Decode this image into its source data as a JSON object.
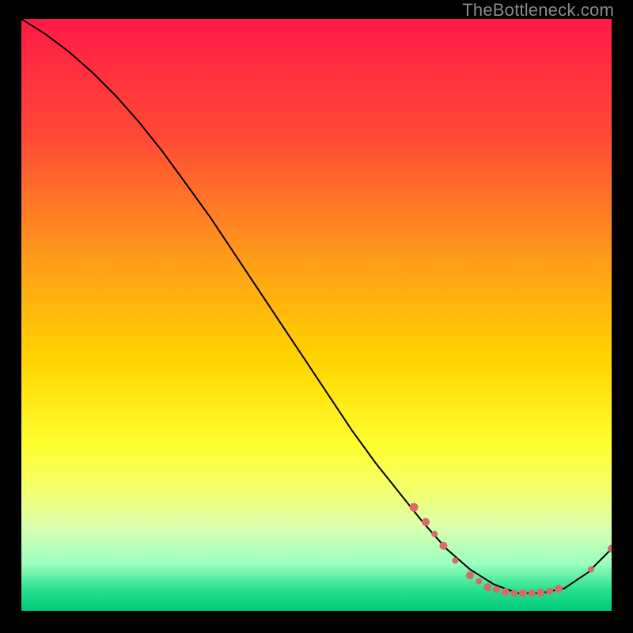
{
  "watermark": "TheBottleneck.com",
  "chart_data": {
    "type": "line",
    "title": "",
    "xlabel": "",
    "ylabel": "",
    "xlim": [
      0,
      100
    ],
    "ylim": [
      0,
      100
    ],
    "grid": false,
    "legend": false,
    "gradient_stops": [
      {
        "offset": 0.0,
        "color": "#ff1a46"
      },
      {
        "offset": 0.2,
        "color": "#ff4a36"
      },
      {
        "offset": 0.4,
        "color": "#ff9a1a"
      },
      {
        "offset": 0.58,
        "color": "#ffd500"
      },
      {
        "offset": 0.72,
        "color": "#ffff30"
      },
      {
        "offset": 0.8,
        "color": "#f4ff70"
      },
      {
        "offset": 0.86,
        "color": "#d8ffb0"
      },
      {
        "offset": 0.92,
        "color": "#9affc0"
      },
      {
        "offset": 0.965,
        "color": "#27e08e"
      },
      {
        "offset": 1.0,
        "color": "#00c97a"
      }
    ],
    "series": [
      {
        "name": "curve",
        "color": "#000000",
        "x": [
          0,
          4,
          8,
          12,
          16,
          20,
          24,
          28,
          32,
          36,
          40,
          44,
          48,
          52,
          56,
          60,
          64,
          68,
          72,
          76,
          80,
          84,
          88,
          92,
          96,
          100
        ],
        "y": [
          100,
          97.5,
          94.5,
          91,
          87,
          82.5,
          77.5,
          72,
          66.5,
          60.5,
          54.5,
          48.5,
          42.5,
          36.5,
          30.5,
          25,
          20,
          15,
          10.5,
          7,
          4.5,
          3,
          3,
          3.8,
          6.5,
          10.5
        ]
      }
    ],
    "markers": {
      "color": "#d86a6a",
      "points": [
        {
          "x": 66.5,
          "y": 17.5,
          "r": 5.5
        },
        {
          "x": 68.5,
          "y": 15.0,
          "r": 5.0
        },
        {
          "x": 70.0,
          "y": 13.0,
          "r": 4.0
        },
        {
          "x": 71.5,
          "y": 11.0,
          "r": 5.0
        },
        {
          "x": 73.5,
          "y": 8.5,
          "r": 4.0
        },
        {
          "x": 76.0,
          "y": 6.0,
          "r": 5.0
        },
        {
          "x": 77.5,
          "y": 5.0,
          "r": 4.0
        },
        {
          "x": 79.0,
          "y": 4.0,
          "r": 5.0
        },
        {
          "x": 80.5,
          "y": 3.6,
          "r": 4.5
        },
        {
          "x": 82.0,
          "y": 3.2,
          "r": 5.0
        },
        {
          "x": 83.5,
          "y": 3.0,
          "r": 4.5
        },
        {
          "x": 85.0,
          "y": 3.0,
          "r": 5.0
        },
        {
          "x": 86.5,
          "y": 3.0,
          "r": 4.5
        },
        {
          "x": 88.0,
          "y": 3.1,
          "r": 5.0
        },
        {
          "x": 89.5,
          "y": 3.3,
          "r": 4.5
        },
        {
          "x": 91.0,
          "y": 3.7,
          "r": 5.0
        },
        {
          "x": 96.5,
          "y": 7.0,
          "r": 4.0
        },
        {
          "x": 100.0,
          "y": 10.5,
          "r": 5.0
        }
      ]
    }
  }
}
